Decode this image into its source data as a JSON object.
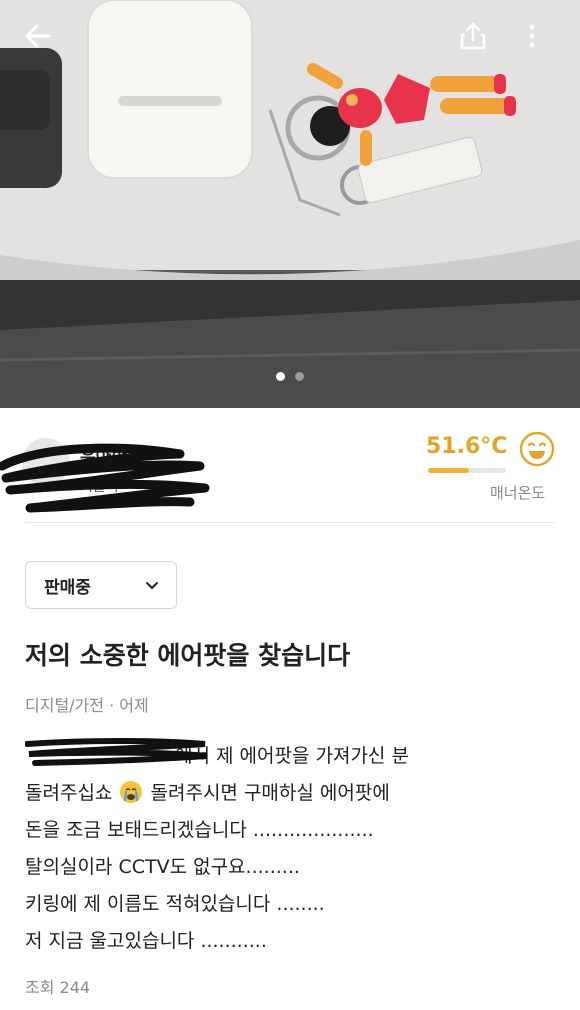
{
  "seller": {
    "name": "우아한",
    "location": "서울시",
    "manner_temp": "51.6°C",
    "manner_temp_value": 51.6,
    "manner_fill_fraction": 0.52,
    "manner_label": "매너온도",
    "temp_color": "#e4a428"
  },
  "carousel": {
    "total": 2,
    "active": 1
  },
  "icons": {
    "back": "back-arrow-icon",
    "share": "share-icon",
    "more": "more-vertical-icon",
    "face": "smiling-face-icon",
    "chevron": "chevron-down-icon",
    "emoji": "crying-face-emoji"
  },
  "status": {
    "label": "판매중"
  },
  "post": {
    "title": "저의 소중한 에어팟을 찾습니다",
    "category": "디지털/가전",
    "time": "· 어제",
    "body_lines": [
      "에서 제 에어팟을 가져가신 분",
      "돌려주십쇼",
      "돌려주시면 구매하실 에어팟에",
      "돈을 조금 보태드리겠습니다 ....................",
      "탈의실이라 CCTV도 없구요.........",
      "키링에 제 이름도 적혀있습니다 ........",
      "저 지금 울고있습니다 ..........."
    ],
    "views": "조회 244"
  }
}
